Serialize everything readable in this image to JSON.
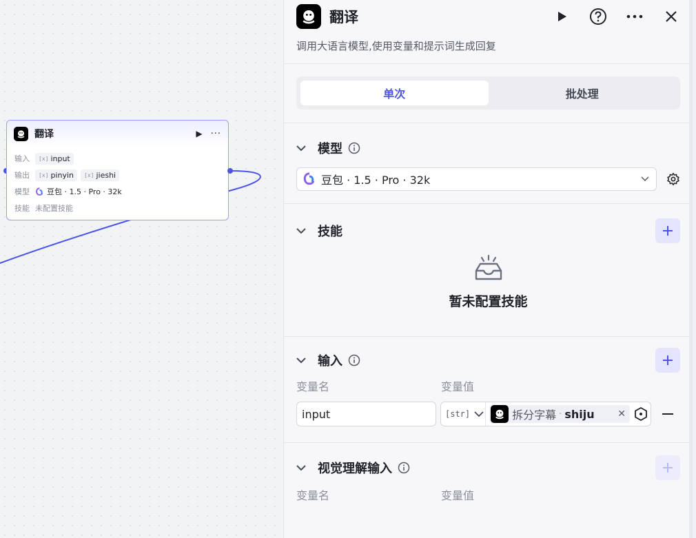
{
  "node": {
    "title": "翻译",
    "input_label": "输入",
    "inputs": [
      "input"
    ],
    "output_label": "输出",
    "outputs": [
      "pinyin",
      "jieshi"
    ],
    "model_label": "模型",
    "model_value": "豆包 · 1.5 · Pro · 32k",
    "skills_label": "技能",
    "skills_value": "未配置技能",
    "var_icon_text": "[x]"
  },
  "panel": {
    "title": "翻译",
    "description": "调用大语言模型,使用变量和提示词生成回复",
    "tabs": [
      {
        "label": "单次",
        "active": true
      },
      {
        "label": "批处理",
        "active": false
      }
    ],
    "model_section": {
      "title": "模型",
      "selected": "豆包 · 1.5 · Pro · 32k"
    },
    "skills_section": {
      "title": "技能",
      "empty_text": "暂未配置技能"
    },
    "input_section": {
      "title": "输入",
      "col_name": "变量名",
      "col_value": "变量值",
      "rows": [
        {
          "name": "input",
          "type": "str",
          "source": "拆分字幕",
          "separator": "·",
          "variable": "shiju"
        }
      ]
    },
    "vision_section": {
      "title": "视觉理解输入",
      "col_name": "变量名",
      "col_value": "变量值"
    }
  },
  "colors": {
    "accent": "#4d53e8",
    "add_button_bg": "#e4e5fc",
    "edge": "#4d53e8"
  },
  "icons": [
    "play-icon",
    "help-icon",
    "more-icon",
    "close-icon",
    "chevron-down-icon",
    "info-icon",
    "plus-icon",
    "settings-icon",
    "inbox-icon",
    "target-icon",
    "minus-icon"
  ]
}
